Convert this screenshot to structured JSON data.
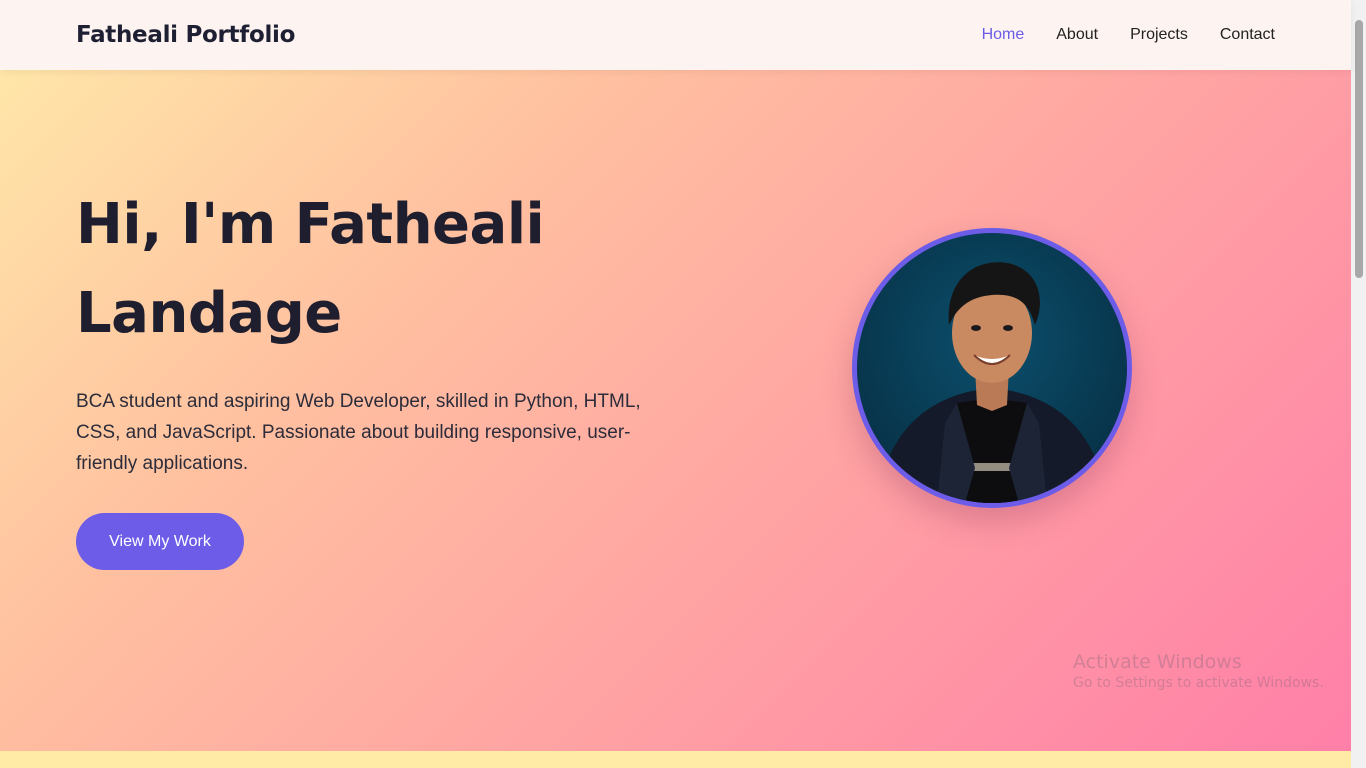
{
  "header": {
    "brand": "Fatheali Portfolio",
    "nav": [
      {
        "label": "Home",
        "active": true
      },
      {
        "label": "About",
        "active": false
      },
      {
        "label": "Projects",
        "active": false
      },
      {
        "label": "Contact",
        "active": false
      }
    ]
  },
  "hero": {
    "title_line1": "Hi, I'm Fatheali",
    "title_line2": "Landage",
    "description": "BCA student and aspiring Web Developer, skilled in Python, HTML, CSS, and JavaScript. Passionate about building responsive, user-friendly applications.",
    "cta_label": "View My Work",
    "avatar_icon": "profile-photo"
  },
  "watermark": {
    "title": "Activate Windows",
    "subtitle": "Go to Settings to activate Windows."
  },
  "colors": {
    "accent": "#6c5ce7",
    "header_bg": "#fdf4f1",
    "gradient_start": "#ffe6a8",
    "gradient_end": "#ff7fa8"
  }
}
